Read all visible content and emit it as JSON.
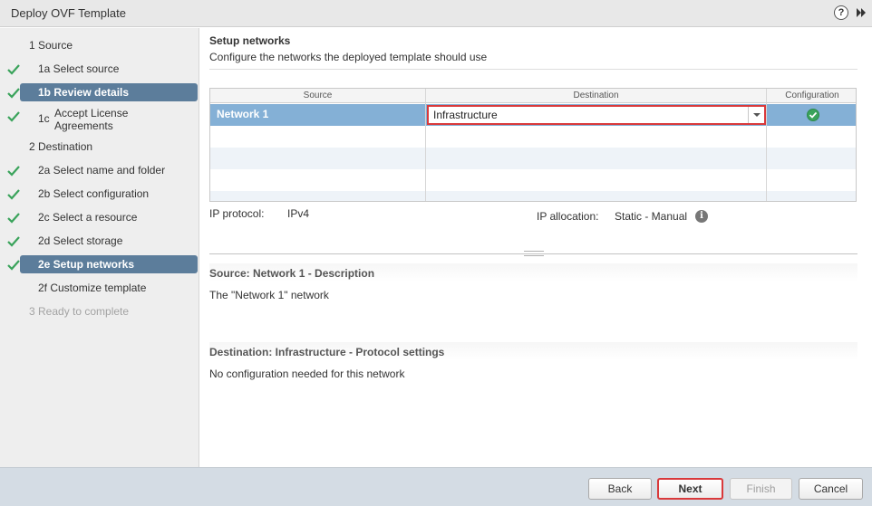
{
  "window": {
    "title": "Deploy OVF Template"
  },
  "icons": {
    "help": "help-icon",
    "expand": "double-chevron-right-icon",
    "check": "check-icon",
    "ok": "ok-status-icon",
    "info": "info-icon"
  },
  "colors": {
    "selected_nav_bg": "#5c7d9b",
    "selected_row_bg": "#84b0d6",
    "check_green": "#3aa35b",
    "highlight_red": "#d9393b"
  },
  "sidebar": {
    "items": [
      {
        "label": "1  Source",
        "checked": false,
        "selected": false,
        "disabled": false
      },
      {
        "label": "1a  Select source",
        "checked": true,
        "selected": false,
        "disabled": false
      },
      {
        "label": "1b  Review details",
        "checked": true,
        "selected": true,
        "disabled": false
      },
      {
        "label": "1c",
        "label2": "Accept License",
        "label3": "Agreements",
        "checked": true,
        "selected": false,
        "disabled": false
      },
      {
        "label": "2  Destination",
        "checked": false,
        "selected": false,
        "disabled": false
      },
      {
        "label": "2a  Select name and folder",
        "checked": true,
        "selected": false,
        "disabled": false
      },
      {
        "label": "2b  Select configuration",
        "checked": true,
        "selected": false,
        "disabled": false
      },
      {
        "label": "2c  Select a resource",
        "checked": true,
        "selected": false,
        "disabled": false
      },
      {
        "label": "2d  Select storage",
        "checked": true,
        "selected": false,
        "disabled": false
      },
      {
        "label": "2e  Setup networks",
        "checked": true,
        "selected": true,
        "disabled": false
      },
      {
        "label": "2f  Customize template",
        "checked": false,
        "selected": false,
        "disabled": false
      },
      {
        "label": "3  Ready to complete",
        "checked": false,
        "selected": false,
        "disabled": true
      }
    ]
  },
  "main": {
    "title": "Setup networks",
    "subtitle": "Configure the networks the deployed template should use",
    "grid": {
      "columns": [
        "Source",
        "Destination",
        "Configuration"
      ],
      "rows": [
        {
          "source": "Network 1",
          "destination": "Infrastructure",
          "configuration_status": "ok"
        }
      ]
    },
    "ip_protocol_label": "IP protocol:",
    "ip_protocol_value": "IPv4",
    "ip_allocation_label": "IP allocation:",
    "ip_allocation_value": "Static - Manual",
    "source_desc_title": "Source: Network 1 - Description",
    "source_desc_text": "The \"Network 1\" network",
    "dest_desc_title": "Destination: Infrastructure - Protocol settings",
    "dest_desc_text": "No configuration needed for this network"
  },
  "footer": {
    "back": "Back",
    "next": "Next",
    "finish": "Finish",
    "cancel": "Cancel"
  }
}
